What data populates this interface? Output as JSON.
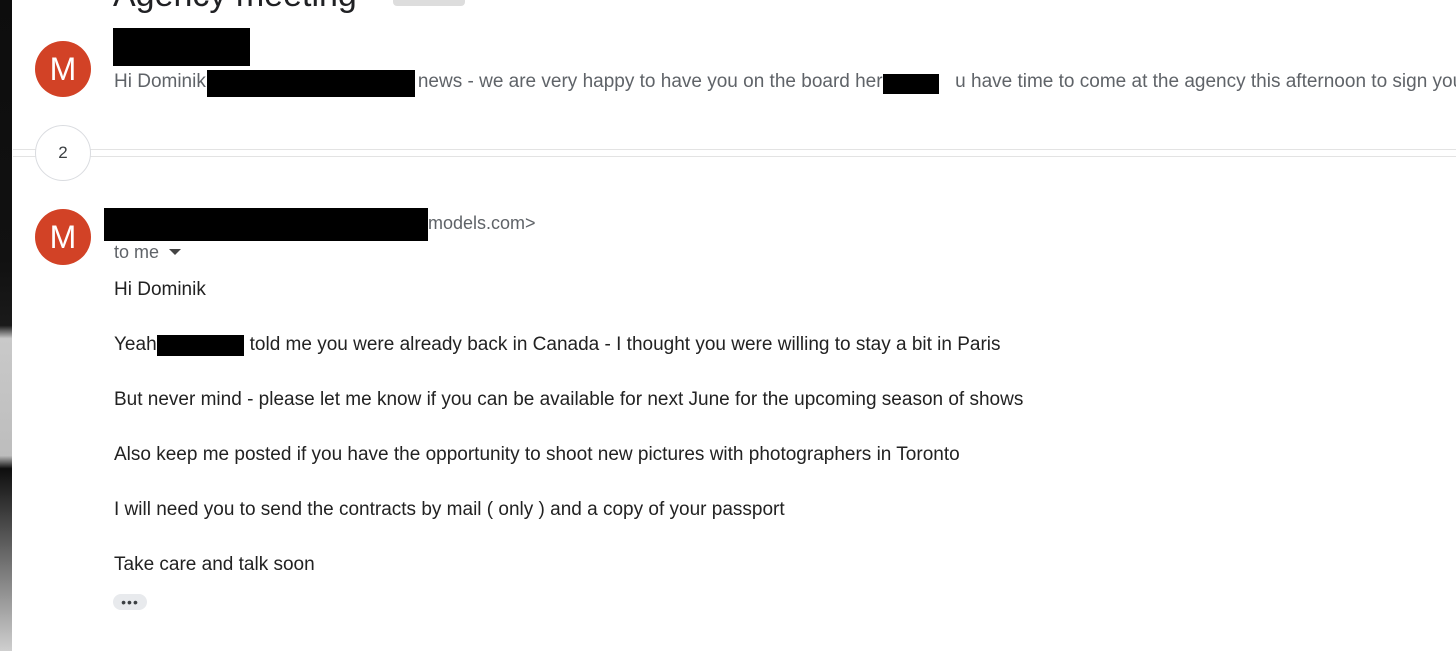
{
  "thread": {
    "subject": "Agency meeting",
    "collapsed_count": "2"
  },
  "messages": [
    {
      "avatar_letter": "M",
      "snippet_greeting": "Hi Dominik",
      "snippet_mid": "news - we are very happy to have you on the board here",
      "snippet_tail": "u have time to come at the agency this afternoon to sign your"
    },
    {
      "avatar_letter": "M",
      "sender_tail": "models.com>",
      "recipient_label": "to me",
      "body": {
        "greeting": "Hi Dominik",
        "line1_start": "Yeah",
        "line1_end": "told me you were already back in Canada - I thought you were willing to stay a bit in Paris",
        "line2": "But never mind - please let me know if you can be available for next June for the upcoming season of shows",
        "line3": "Also keep me posted if you have the opportunity to shoot new pictures with photographers in Toronto",
        "line4": "I will need you to send the contracts by mail ( only ) and a copy of your passport",
        "line5": "Take care and talk soon"
      },
      "expand_label": "•••"
    }
  ],
  "colors": {
    "avatar_bg": "#d24226",
    "redaction": "#000000",
    "text_secondary": "#5f6368",
    "text_primary": "#222222"
  },
  "icons": {
    "recipient_details": "caret-down-icon",
    "show_trimmed": "ellipsis-icon"
  }
}
